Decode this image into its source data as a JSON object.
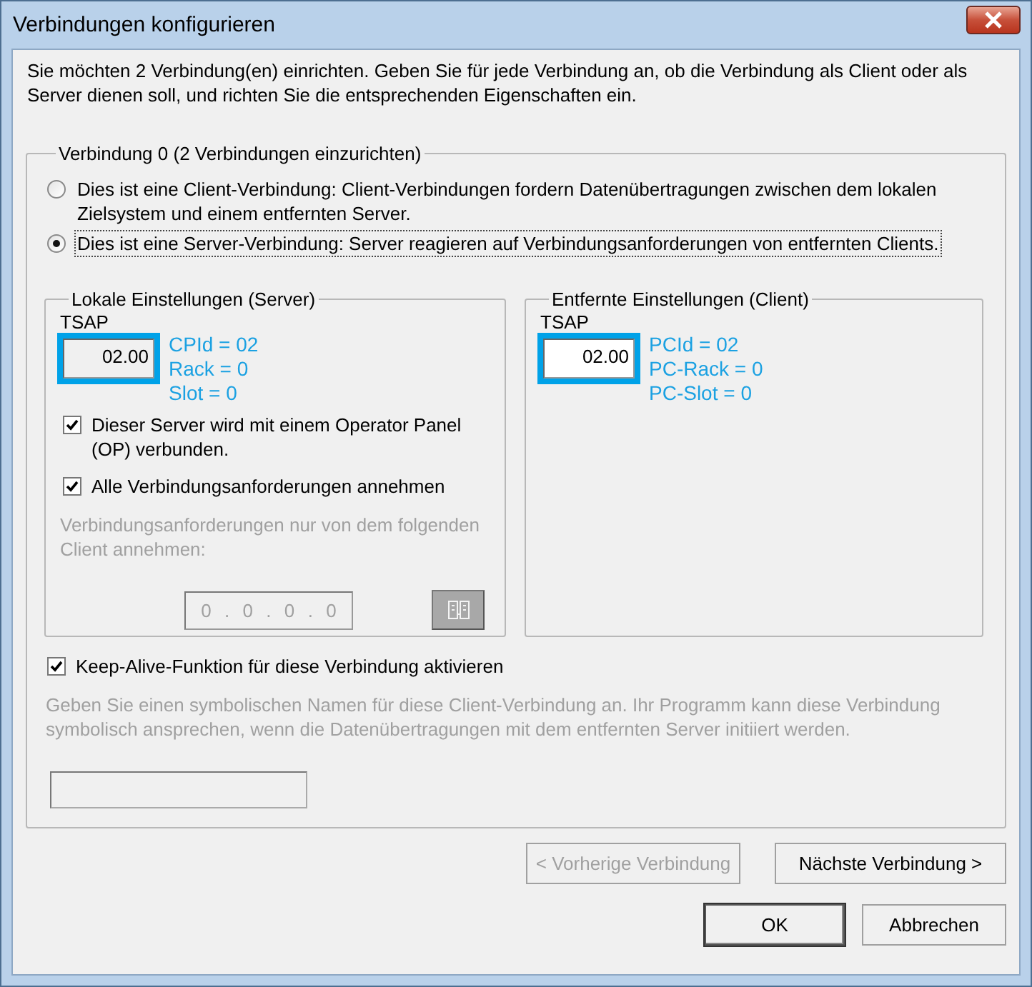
{
  "window": {
    "title": "Verbindungen konfigurieren"
  },
  "intro": "Sie möchten 2 Verbindung(en) einrichten. Geben Sie für jede Verbindung an, ob die Verbindung als Client oder als Server dienen soll, und richten Sie die entsprechenden Eigenschaften ein.",
  "connection_group": {
    "title": "Verbindung 0 (2 Verbindungen einzurichten)",
    "options": [
      {
        "label": "Dies ist eine Client-Verbindung: Client-Verbindungen fordern Datenübertragungen zwischen dem lokalen Zielsystem und einem entfernten Server.",
        "selected": false
      },
      {
        "label": "Dies ist eine Server-Verbindung: Server reagieren auf Verbindungsanforderungen von entfernten Clients.",
        "selected": true
      }
    ],
    "local": {
      "title": "Lokale Einstellungen (Server)",
      "tsap_label": "TSAP",
      "tsap_value": "02.00",
      "tsap_disabled": true,
      "annotations": [
        "CPId = 02",
        "Rack = 0",
        "Slot = 0"
      ],
      "checkboxes": [
        {
          "label": "Dieser Server wird mit einem Operator Panel (OP) verbunden.",
          "checked": true
        },
        {
          "label": "Alle Verbindungsanforderungen annehmen",
          "checked": true
        }
      ],
      "client_hint": "Verbindungsanforderungen nur von dem folgenden Client annehmen:",
      "ip_octets": [
        "0",
        "0",
        "0",
        "0"
      ],
      "ip_separator": ".",
      "client_disabled": true
    },
    "remote": {
      "title": "Entfernte Einstellungen (Client)",
      "tsap_label": "TSAP",
      "tsap_value": "02.00",
      "tsap_disabled": false,
      "annotations": [
        "PCId = 02",
        "PC-Rack = 0",
        "PC-Slot = 0"
      ]
    },
    "keep_alive": {
      "label": "Keep-Alive-Funktion für diese Verbindung aktivieren",
      "checked": true
    },
    "symbolic_hint": "Geben Sie einen symbolischen Namen für diese Client-Verbindung an. Ihr Programm kann diese Verbindung symbolisch ansprechen, wenn die Datenübertragungen mit dem entfernten Server initiiert werden.",
    "symbolic_disabled": true
  },
  "nav_buttons": [
    {
      "label": "< Vorherige Verbindung",
      "disabled": true
    },
    {
      "label": "Nächste Verbindung >",
      "disabled": false
    }
  ],
  "dialog_buttons": [
    {
      "label": "OK",
      "default": true
    },
    {
      "label": "Abbrechen",
      "default": false
    }
  ]
}
